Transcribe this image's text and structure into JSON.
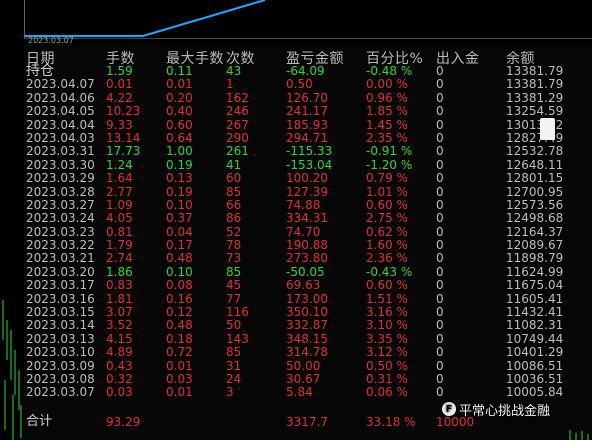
{
  "chart": {
    "date_label": "2023.03.07"
  },
  "table": {
    "headers": {
      "date": "日期",
      "lots": "手数",
      "max_lots": "最大手数",
      "count": "次数",
      "pnl": "盈亏金额",
      "pct": "百分比%",
      "io": "出入金",
      "balance": "余额"
    },
    "position_row": {
      "date": "持仓",
      "lots": "1.59",
      "max_lots": "0.11",
      "count": "43",
      "pnl": "-64.09",
      "pct": "-0.48 %",
      "io": "0",
      "balance": "13381.79",
      "sign": "neg"
    },
    "rows": [
      {
        "date": "2023.04.07",
        "lots": "0.01",
        "max_lots": "0.01",
        "count": "1",
        "pnl": "0.50",
        "pct": "0.00 %",
        "io": "0",
        "balance": "13381.79",
        "sign": "pos"
      },
      {
        "date": "2023.04.06",
        "lots": "4.22",
        "max_lots": "0.20",
        "count": "162",
        "pnl": "126.70",
        "pct": "0.96 %",
        "io": "0",
        "balance": "13381.29",
        "sign": "pos"
      },
      {
        "date": "2023.04.05",
        "lots": "10.23",
        "max_lots": "0.40",
        "count": "246",
        "pnl": "241.17",
        "pct": "1.85 %",
        "io": "0",
        "balance": "13254.59",
        "sign": "pos"
      },
      {
        "date": "2023.04.04",
        "lots": "9.33",
        "max_lots": "0.60",
        "count": "267",
        "pnl": "185.93",
        "pct": "1.45 %",
        "io": "0",
        "balance": "13013.42",
        "sign": "pos"
      },
      {
        "date": "2023.04.03",
        "lots": "13.14",
        "max_lots": "0.64",
        "count": "290",
        "pnl": "294.71",
        "pct": "2.35 %",
        "io": "0",
        "balance": "12827.49",
        "sign": "pos"
      },
      {
        "date": "2023.03.31",
        "lots": "17.73",
        "max_lots": "1.00",
        "count": "261",
        "pnl": "-115.33",
        "pct": "-0.91 %",
        "io": "0",
        "balance": "12532.78",
        "sign": "neg"
      },
      {
        "date": "2023.03.30",
        "lots": "1.24",
        "max_lots": "0.19",
        "count": "41",
        "pnl": "-153.04",
        "pct": "-1.20 %",
        "io": "0",
        "balance": "12648.11",
        "sign": "neg"
      },
      {
        "date": "2023.03.29",
        "lots": "1.64",
        "max_lots": "0.13",
        "count": "60",
        "pnl": "100.20",
        "pct": "0.79 %",
        "io": "0",
        "balance": "12801.15",
        "sign": "pos"
      },
      {
        "date": "2023.03.28",
        "lots": "2.77",
        "max_lots": "0.19",
        "count": "85",
        "pnl": "127.39",
        "pct": "1.01 %",
        "io": "0",
        "balance": "12700.95",
        "sign": "pos"
      },
      {
        "date": "2023.03.27",
        "lots": "1.09",
        "max_lots": "0.10",
        "count": "66",
        "pnl": "74.88",
        "pct": "0.60 %",
        "io": "0",
        "balance": "12573.56",
        "sign": "pos"
      },
      {
        "date": "2023.03.24",
        "lots": "4.05",
        "max_lots": "0.37",
        "count": "86",
        "pnl": "334.31",
        "pct": "2.75 %",
        "io": "0",
        "balance": "12498.68",
        "sign": "pos"
      },
      {
        "date": "2023.03.23",
        "lots": "0.81",
        "max_lots": "0.04",
        "count": "52",
        "pnl": "74.70",
        "pct": "0.62 %",
        "io": "0",
        "balance": "12164.37",
        "sign": "pos"
      },
      {
        "date": "2023.03.22",
        "lots": "1.79",
        "max_lots": "0.17",
        "count": "78",
        "pnl": "190.88",
        "pct": "1.60 %",
        "io": "0",
        "balance": "12089.67",
        "sign": "pos"
      },
      {
        "date": "2023.03.21",
        "lots": "2.74",
        "max_lots": "0.48",
        "count": "73",
        "pnl": "273.80",
        "pct": "2.36 %",
        "io": "0",
        "balance": "11898.79",
        "sign": "pos"
      },
      {
        "date": "2023.03.20",
        "lots": "1.86",
        "max_lots": "0.10",
        "count": "85",
        "pnl": "-50.05",
        "pct": "-0.43 %",
        "io": "0",
        "balance": "11624.99",
        "sign": "neg"
      },
      {
        "date": "2023.03.17",
        "lots": "0.83",
        "max_lots": "0.08",
        "count": "45",
        "pnl": "69.63",
        "pct": "0.60 %",
        "io": "0",
        "balance": "11675.04",
        "sign": "pos"
      },
      {
        "date": "2023.03.16",
        "lots": "1.81",
        "max_lots": "0.16",
        "count": "77",
        "pnl": "173.00",
        "pct": "1.51 %",
        "io": "0",
        "balance": "11605.41",
        "sign": "pos"
      },
      {
        "date": "2023.03.15",
        "lots": "3.07",
        "max_lots": "0.12",
        "count": "116",
        "pnl": "350.10",
        "pct": "3.16 %",
        "io": "0",
        "balance": "11432.41",
        "sign": "pos"
      },
      {
        "date": "2023.03.14",
        "lots": "3.52",
        "max_lots": "0.48",
        "count": "50",
        "pnl": "332.87",
        "pct": "3.10 %",
        "io": "0",
        "balance": "11082.31",
        "sign": "pos"
      },
      {
        "date": "2023.03.13",
        "lots": "4.15",
        "max_lots": "0.18",
        "count": "143",
        "pnl": "348.15",
        "pct": "3.35 %",
        "io": "0",
        "balance": "10749.44",
        "sign": "pos"
      },
      {
        "date": "2023.03.10",
        "lots": "4.89",
        "max_lots": "0.72",
        "count": "85",
        "pnl": "314.78",
        "pct": "3.12 %",
        "io": "0",
        "balance": "10401.29",
        "sign": "pos"
      },
      {
        "date": "2023.03.09",
        "lots": "0.43",
        "max_lots": "0.01",
        "count": "31",
        "pnl": "50.00",
        "pct": "0.50 %",
        "io": "0",
        "balance": "10086.51",
        "sign": "pos"
      },
      {
        "date": "2023.03.08",
        "lots": "0.32",
        "max_lots": "0.03",
        "count": "24",
        "pnl": "30.67",
        "pct": "0.31 %",
        "io": "0",
        "balance": "10036.51",
        "sign": "pos"
      },
      {
        "date": "2023.03.07",
        "lots": "0.03",
        "max_lots": "0.01",
        "count": "3",
        "pnl": "5.84",
        "pct": "0.06 %",
        "io": "0",
        "balance": "10005.84",
        "sign": "pos"
      }
    ],
    "total": {
      "label": "合计",
      "lots": "93.29",
      "pnl": "3317.7",
      "pct": "33.18 %",
      "io": "10000"
    }
  },
  "brand": {
    "icon": "F",
    "text": "平常心挑战金融"
  },
  "colors": {
    "positive": "#e03030",
    "negative": "#2ed82e",
    "equity_line": "#1ea7ff"
  }
}
